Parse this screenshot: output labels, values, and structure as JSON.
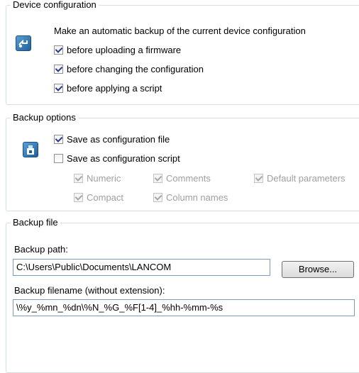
{
  "device_configuration": {
    "title": "Device configuration",
    "description": "Make an automatic backup of the current device configuration",
    "options": [
      {
        "label": "before uploading a firmware",
        "checked": true
      },
      {
        "label": "before changing the configuration",
        "checked": true
      },
      {
        "label": "before applying a script",
        "checked": true
      }
    ]
  },
  "backup_options": {
    "title": "Backup options",
    "save_as_file": {
      "label": "Save as configuration file",
      "checked": true
    },
    "save_as_script": {
      "label": "Save as configuration script",
      "checked": false
    },
    "script_options": [
      {
        "label": "Numeric",
        "checked": true,
        "enabled": false
      },
      {
        "label": "Comments",
        "checked": true,
        "enabled": false
      },
      {
        "label": "Default parameters",
        "checked": true,
        "enabled": false
      },
      {
        "label": "Compact",
        "checked": true,
        "enabled": false
      },
      {
        "label": "Column names",
        "checked": true,
        "enabled": false
      }
    ]
  },
  "backup_file": {
    "title": "Backup file",
    "path_label": "Backup path:",
    "path_value": "C:\\Users\\Public\\Documents\\LANCOM",
    "browse_label": "Browse...",
    "filename_label": "Backup filename (without extension):",
    "filename_value": "\\%y_%mn_%dn\\%N_%G_%F[1-4]_%hh-%mm-%s"
  },
  "icons": {
    "device_config": "device-config-icon",
    "backup_options": "backup-save-icon"
  }
}
